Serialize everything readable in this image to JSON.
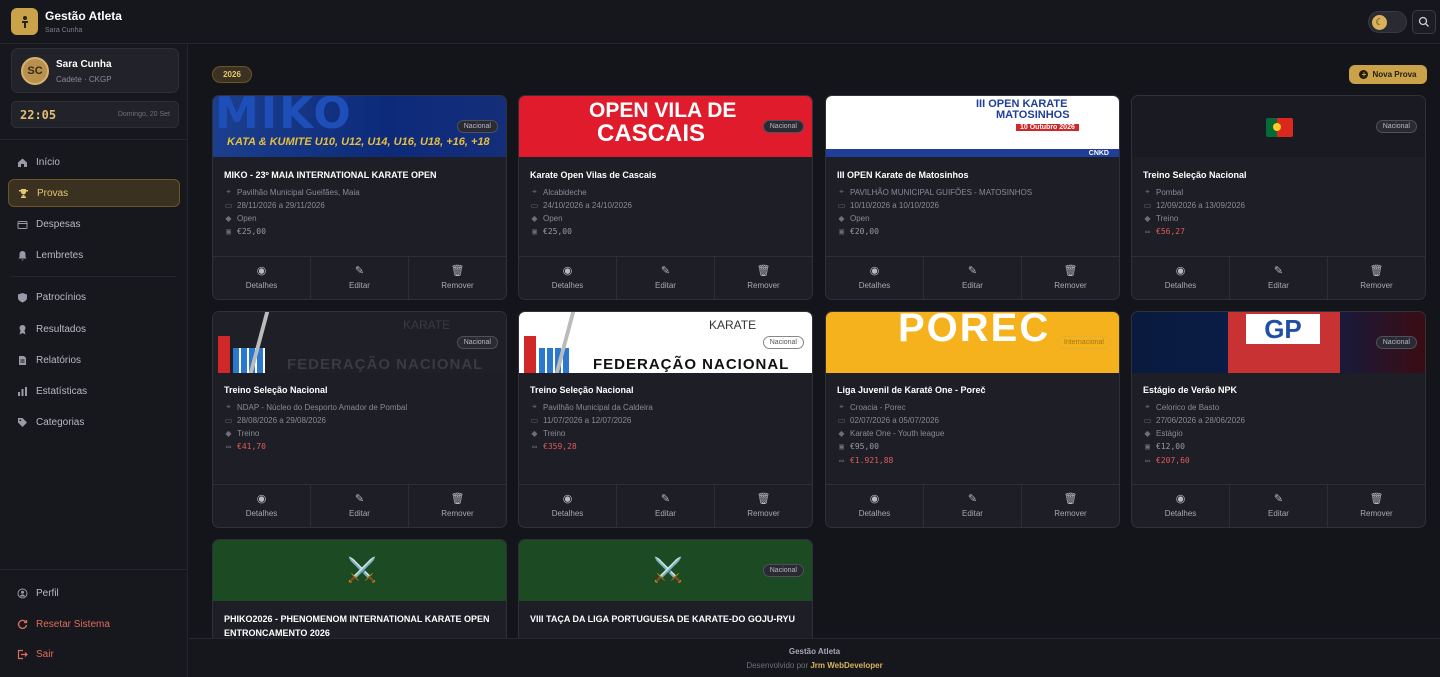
{
  "header": {
    "title": "Gestão Atleta",
    "subtitle": "Sara Cunha"
  },
  "user": {
    "name": "Sara Cunha",
    "role": "Cadete · CKGP",
    "initials": "SC"
  },
  "clock": {
    "time": "22:05",
    "date": "Domingo, 20 Set"
  },
  "sidebar": {
    "items": [
      {
        "label": "Início",
        "icon": "home-icon"
      },
      {
        "label": "Provas",
        "icon": "trophy-icon"
      },
      {
        "label": "Despesas",
        "icon": "wallet-icon"
      },
      {
        "label": "Lembretes",
        "icon": "bell-icon"
      },
      {
        "label": "Patrocínios",
        "icon": "shield-icon"
      },
      {
        "label": "Resultados",
        "icon": "medal-icon"
      },
      {
        "label": "Relatórios",
        "icon": "document-icon"
      },
      {
        "label": "Estatísticas",
        "icon": "bar-chart-icon"
      },
      {
        "label": "Categorias",
        "icon": "tag-icon"
      }
    ],
    "bottom": [
      {
        "label": "Perfil",
        "icon": "user-icon"
      },
      {
        "label": "Resetar Sistema",
        "icon": "reset-icon"
      },
      {
        "label": "Sair",
        "icon": "logout-icon"
      }
    ]
  },
  "main": {
    "year": "2026",
    "new_button": "Nova Prova",
    "actions": {
      "details": "Detalhes",
      "edit": "Editar",
      "remove": "Remover"
    },
    "cards": [
      {
        "title": "MIKO - 23º MAIA INTERNATIONAL KARATE OPEN",
        "badge": "Nacional",
        "location": "Pavilhão Municipal Gueifães, Maia",
        "dates": "28/11/2026 a 29/11/2026",
        "category": "Open",
        "fee": "€25,00",
        "extra": "",
        "image_text": "MIKO",
        "image_sub": "KATA & KUMITE U10, U12, U14, U16, U18, +16, +18"
      },
      {
        "title": "Karate Open Vilas de Cascais",
        "badge": "Nacional",
        "location": "Alcabideche",
        "dates": "24/10/2026 a 24/10/2026",
        "category": "Open",
        "fee": "€25,00",
        "extra": "",
        "image_text": "OPEN VILA DE",
        "image_sub": "CASCAIS"
      },
      {
        "title": "III OPEN Karate de Matosinhos",
        "badge": "",
        "location": "PAVILHÃO MUNICIPAL GUIFÕES - MATOSINHOS",
        "dates": "10/10/2026 a 10/10/2026",
        "category": "Open",
        "fee": "€20,00",
        "extra": "",
        "image_text": "III OPEN KARATE",
        "image_sub": "MATOSINHOS",
        "image_date": "10 Outubro 2026",
        "image_org": "CNKD"
      },
      {
        "title": "Treino Seleção Nacional",
        "badge": "Nacional",
        "location": "Pombal",
        "dates": "12/09/2026 a 13/09/2026",
        "category": "Treino",
        "fee": "",
        "extra": "€56,27"
      },
      {
        "title": "Treino Seleção Nacional",
        "badge": "Nacional",
        "location": "NDAP - Núcleo do Desporto Amador de Pombal",
        "dates": "28/08/2026 a 29/08/2026",
        "category": "Treino",
        "fee": "",
        "extra": "€41,70",
        "image_text": "KARATE",
        "image_sub": "FEDERAÇÃO NACIONAL"
      },
      {
        "title": "Treino Seleção Nacional",
        "badge": "Nacional",
        "location": "Pavilhão Municipal da Caldeira",
        "dates": "11/07/2026 a 12/07/2026",
        "category": "Treino",
        "fee": "",
        "extra": "€359,28",
        "image_text": "KARATE",
        "image_sub": "FEDERAÇÃO NACIONAL"
      },
      {
        "title": "Liga Juvenil de Karatê One - Poreč",
        "badge": "Internacional",
        "location": "Croacia - Porec",
        "dates": "02/07/2026 a 05/07/2026",
        "category": "Karate One - Youth league",
        "fee": "€95,00",
        "extra": "€1.921,88",
        "image_text": "POREC"
      },
      {
        "title": "Estágio de Verão NPK",
        "badge": "Nacional",
        "location": "Celorico de Basto",
        "dates": "27/06/2026 a 28/06/2026",
        "category": "Estágio",
        "fee": "€12,00",
        "extra": "€207,60",
        "image_text": "GP"
      },
      {
        "title": "PHIKO2026 - PHENOMENOM INTERNATIONAL KARATE OPEN ENTRONCAMENTO 2026",
        "badge": ""
      },
      {
        "title": "VIII TAÇA DA LIGA PORTUGUESA DE KARATE-DO GOJU-RYU",
        "badge": "Nacional"
      }
    ]
  },
  "footer": {
    "line1": "Gestão Atleta",
    "line2_prefix": "Desenvolvido por",
    "line2_author": "Jrm WebDeveloper"
  },
  "colors": {
    "accent": "#c9a24a",
    "background": "#14141b",
    "card": "#1e1e26",
    "danger": "#e05b5b"
  }
}
